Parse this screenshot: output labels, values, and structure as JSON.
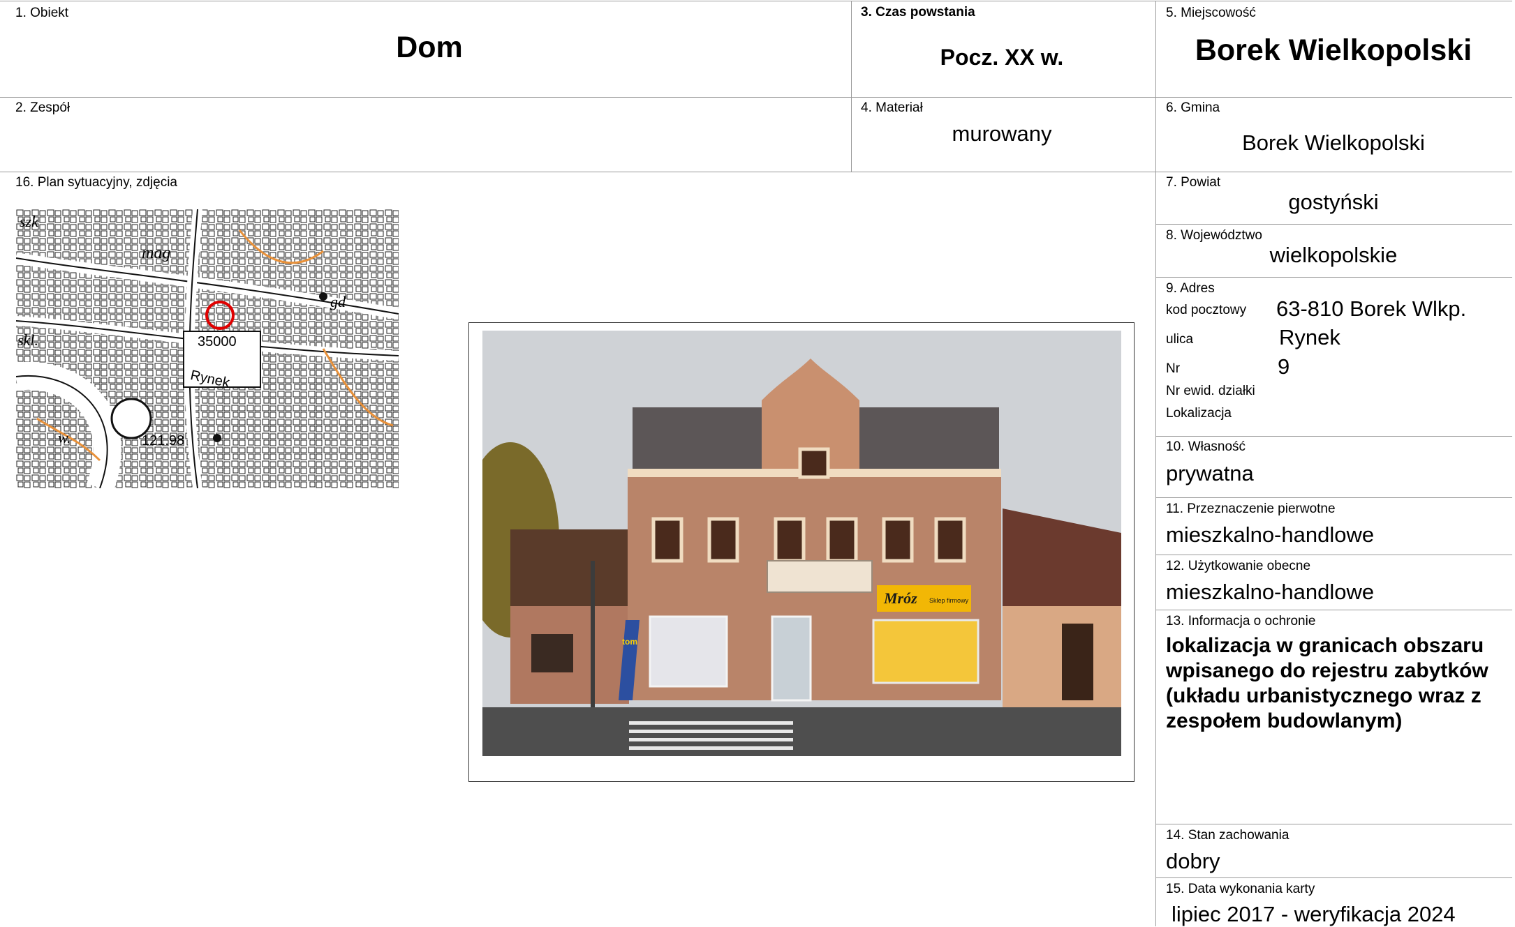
{
  "fields": {
    "obiekt": {
      "label": "1. Obiekt",
      "value": "Dom"
    },
    "zespol": {
      "label": "2. Zespół",
      "value": ""
    },
    "czas": {
      "label": "3. Czas powstania",
      "value": "Pocz. XX w."
    },
    "material": {
      "label": "4. Materiał",
      "value": "murowany"
    },
    "miejscowosc": {
      "label": "5. Miejscowość",
      "value": "Borek Wielkopolski"
    },
    "gmina": {
      "label": "6. Gmina",
      "value": "Borek Wielkopolski"
    },
    "powiat": {
      "label": "7. Powiat",
      "value": "gostyński"
    },
    "wojewodztwo": {
      "label": "8. Województwo",
      "value": "wielkopolskie"
    },
    "adres": {
      "label": "9. Adres",
      "kod_label": "kod pocztowy",
      "kod_value": "63-810 Borek Wlkp.",
      "ulica_label": "ulica",
      "ulica_value": "Rynek",
      "nr_label": "Nr",
      "nr_value": "9",
      "dzialka_label": "Nr ewid. działki",
      "lokalizacja_label": "Lokalizacja"
    },
    "wlasnosc": {
      "label": "10. Własność",
      "value": "prywatna"
    },
    "przeznaczenie": {
      "label": "11. Przeznaczenie pierwotne",
      "value": "mieszkalno-handlowe"
    },
    "uzytkowanie": {
      "label": "12. Użytkowanie obecne",
      "value": "mieszkalno-handlowe"
    },
    "ochrona": {
      "label": "13. Informacja o ochronie",
      "value": "lokalizacja w granicach obszaru wpisanego do rejestru zabytków (układu urbanistycznego wraz z zespołem budowlanym)"
    },
    "stan": {
      "label": "14. Stan zachowania",
      "value": "dobry"
    },
    "data": {
      "label": "15. Data wykonania karty",
      "value": "lipiec 2017 - weryfikacja 2024"
    },
    "plan": {
      "label": "16. Plan sytuacyjny, zdjęcia"
    }
  },
  "map": {
    "labels": [
      "szk",
      "mag",
      "35000",
      "Rynek",
      "skl.",
      "121.98",
      "w.",
      "gd"
    ]
  },
  "photo": {
    "signs": [
      "Mróz",
      "Sklep firmowy",
      "tom"
    ]
  },
  "colors": {
    "rule": "#9a9a9a",
    "marker": "#e00000",
    "sign": "#f2b705"
  }
}
